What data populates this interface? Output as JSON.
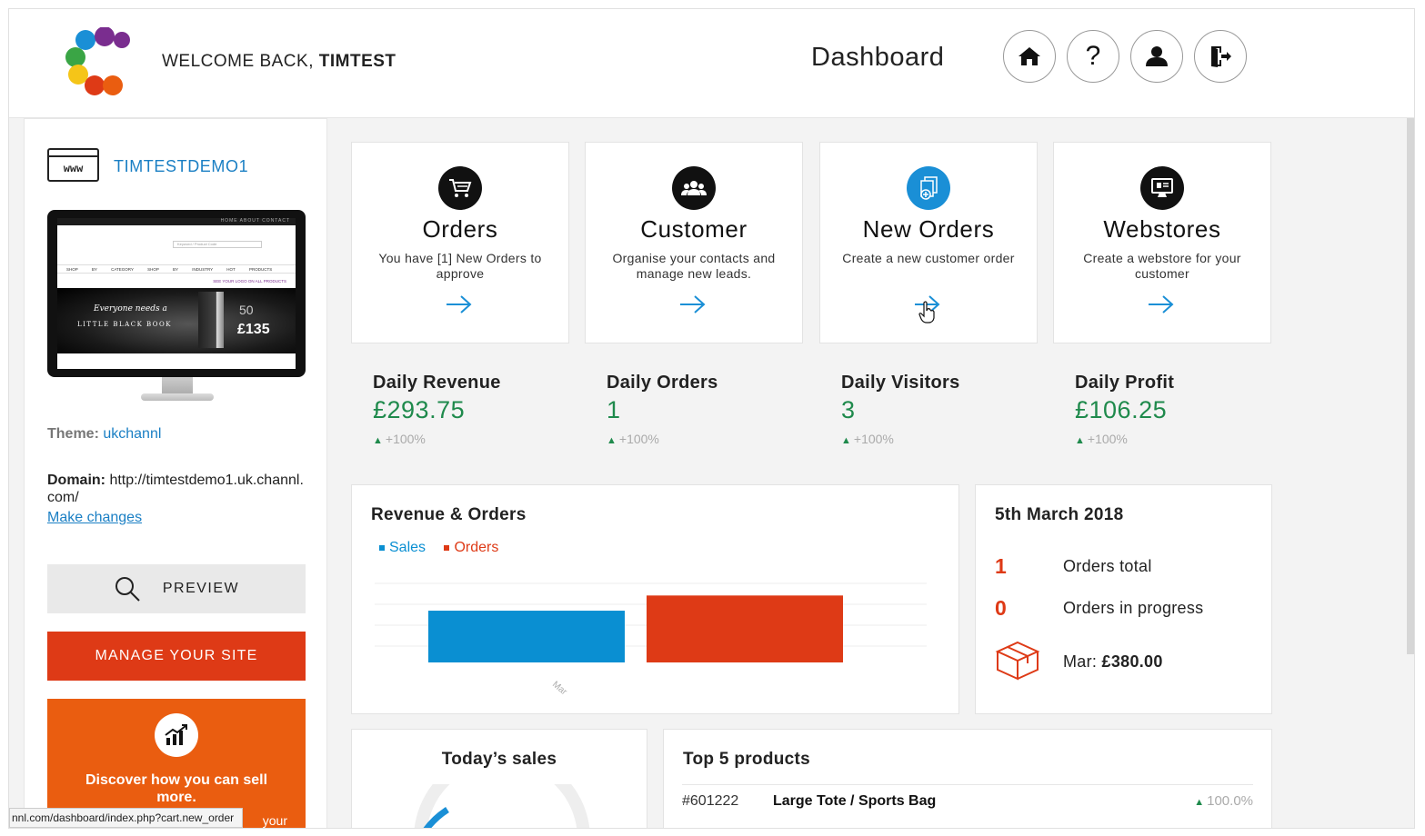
{
  "header": {
    "welcome_prefix": "WELCOME BACK,",
    "username": "TIMTEST",
    "page_title": "Dashboard",
    "buttons": [
      "home-icon",
      "help-icon",
      "user-icon",
      "logout-icon"
    ]
  },
  "sidebar": {
    "store_name": "TIMTESTDEMO1",
    "preview_site": {
      "nav_links": "HOME ABOUT CONTACT",
      "search_placeholder": "Keyword / Product Code",
      "menu": "SHOP BY CATEGORY SHOP BY INDUSTRY HOT PRODUCTS",
      "logo_line": "SEE YOUR LOGO ON ALL PRODUCTS",
      "hero_line1": "Everyone needs a",
      "hero_line2": "LITTLE BLACK BOOK",
      "hero_qty": "50",
      "hero_price": "£135"
    },
    "theme_label": "Theme:",
    "theme_value": "ukchannl",
    "domain_label": "Domain:",
    "domain_value": "http://timtestdemo1.uk.channl.com/",
    "make_changes": "Make changes",
    "preview_button": "PREVIEW",
    "manage_button": "MANAGE YOUR SITE",
    "promo_text": "Discover how you can sell more.",
    "promo_sub": "your"
  },
  "tiles": [
    {
      "title": "Orders",
      "desc": "You have [1] New Orders to approve",
      "icon": "cart-icon",
      "color": "#111111"
    },
    {
      "title": "Customer",
      "desc": "Organise your contacts and manage new leads.",
      "icon": "people-icon",
      "color": "#111111"
    },
    {
      "title": "New Orders",
      "desc": "Create a new customer order",
      "icon": "new-order-icon",
      "color": "#1a8fd6"
    },
    {
      "title": "Webstores",
      "desc": "Create a webstore for your customer",
      "icon": "monitor-icon",
      "color": "#111111"
    }
  ],
  "stats": [
    {
      "label": "Daily Revenue",
      "value": "£293.75",
      "change": "+100%"
    },
    {
      "label": "Daily Orders",
      "value": "1",
      "change": "+100%"
    },
    {
      "label": "Daily Visitors",
      "value": "3",
      "change": "+100%"
    },
    {
      "label": "Daily Profit",
      "value": "£106.25",
      "change": "+100%"
    }
  ],
  "revenue_panel": {
    "title": "Revenue & Orders",
    "legend": [
      {
        "name": "Sales",
        "color": "#0a8fd2"
      },
      {
        "name": "Orders",
        "color": "#de3a16"
      }
    ]
  },
  "chart_data": {
    "type": "bar",
    "categories": [
      "Mar"
    ],
    "series": [
      {
        "name": "Sales",
        "values": [
          293.75
        ],
        "color": "#0a8fd2"
      },
      {
        "name": "Orders",
        "values": [
          380.0
        ],
        "color": "#de3a16"
      }
    ],
    "ylim": [
      0,
      490
    ],
    "grid": true,
    "legend": "top-left"
  },
  "summary": {
    "date": "5th March 2018",
    "orders_total_num": "1",
    "orders_total_label": "Orders total",
    "in_progress_num": "0",
    "in_progress_label": "Orders in progress",
    "month_label": "Mar:",
    "month_value": "£380.00"
  },
  "todays_sales": {
    "title": "Today’s sales"
  },
  "top_products": {
    "title": "Top 5 products",
    "rows": [
      {
        "code": "#601222",
        "name": "Large Tote / Sports Bag",
        "change": "100.0%"
      }
    ]
  },
  "status_url": "nnl.com/dashboard/index.php?cart.new_order"
}
